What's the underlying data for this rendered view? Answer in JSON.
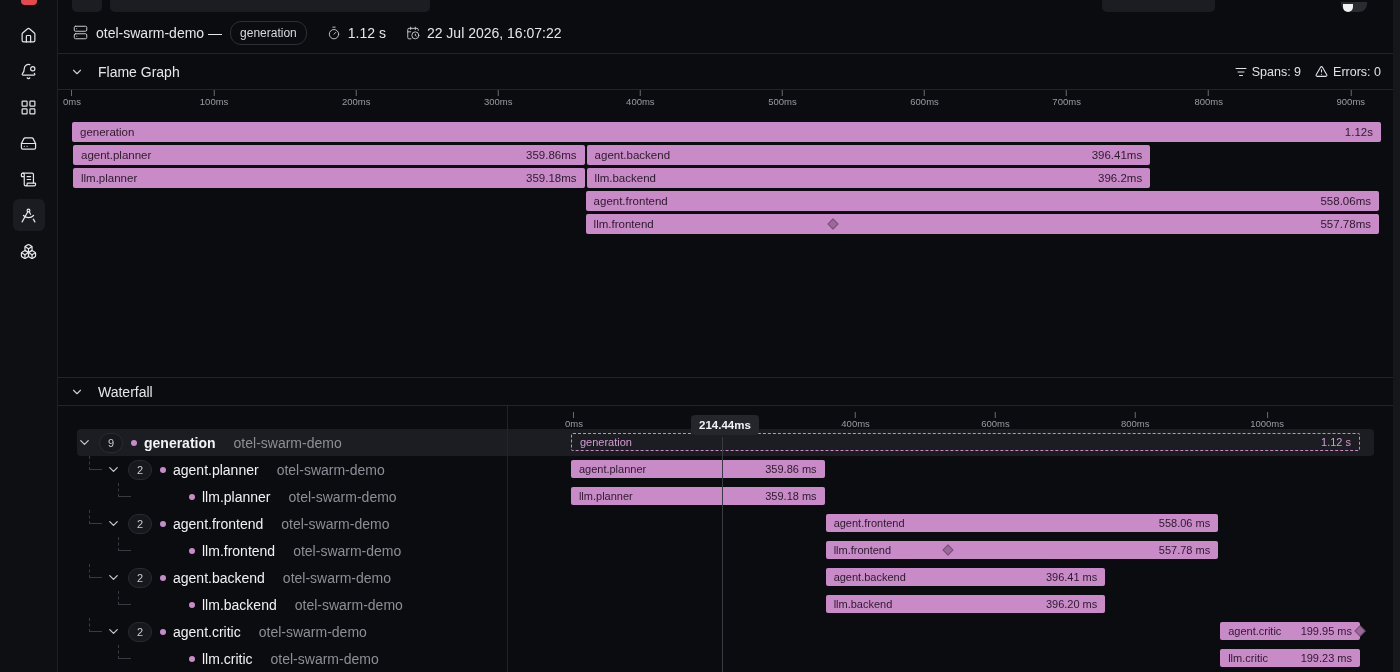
{
  "sidebar": {
    "items": [
      {
        "selected": false
      },
      {
        "selected": false
      },
      {
        "selected": false
      },
      {
        "selected": false
      },
      {
        "selected": false
      },
      {
        "selected": true
      },
      {
        "selected": false
      }
    ]
  },
  "toolbar": {
    "highlight_errors": {
      "on": false
    }
  },
  "header": {
    "service": "otel-swarm-demo —",
    "span_tag": "generation",
    "duration": "1.12 s",
    "timestamp": "22 Jul 2026, 16:07:22"
  },
  "flame_graph": {
    "title": "Flame Graph",
    "expanded": true,
    "spans_count": "Spans: 9",
    "errors_count": "Errors: 0",
    "axis_ticks": [
      "0ms",
      "100ms",
      "200ms",
      "300ms",
      "400ms",
      "500ms",
      "600ms",
      "700ms",
      "800ms",
      "900ms"
    ],
    "rows": [
      [
        {
          "name": "generation",
          "duration": "1.12s"
        }
      ],
      [
        {
          "name": "agent.planner",
          "duration": "359.86ms"
        },
        {
          "name": "agent.backend",
          "duration": "396.41ms"
        }
      ],
      [
        {
          "name": "llm.planner",
          "duration": "359.18ms"
        },
        {
          "name": "llm.backend",
          "duration": "396.2ms"
        }
      ],
      [
        {
          "name": "agent.frontend",
          "duration": "558.06ms"
        }
      ],
      [
        {
          "name": "llm.frontend",
          "duration": "557.78ms",
          "marker": true
        }
      ]
    ]
  },
  "waterfall": {
    "title": "Waterfall",
    "expanded": true,
    "axis_ticks": [
      "0ms",
      "400ms",
      "600ms",
      "800ms",
      "1000ms"
    ],
    "cursor_label": "214.44ms",
    "spans": [
      {
        "name": "generation",
        "service": "otel-swarm-demo",
        "count": "9",
        "expanded": true,
        "selected": true,
        "bar_label": "generation",
        "duration": "1.12 s",
        "children": [
          {
            "name": "agent.planner",
            "service": "otel-swarm-demo",
            "count": "2",
            "expanded": true,
            "selected": false,
            "bar_label": "agent.planner",
            "duration": "359.86 ms",
            "children": [
              {
                "name": "llm.planner",
                "service": "otel-swarm-demo",
                "selected": false,
                "bar_label": "llm.planner",
                "duration": "359.18 ms"
              }
            ]
          },
          {
            "name": "agent.frontend",
            "service": "otel-swarm-demo",
            "count": "2",
            "expanded": true,
            "selected": false,
            "bar_label": "agent.frontend",
            "duration": "558.06 ms",
            "children": [
              {
                "name": "llm.frontend",
                "service": "otel-swarm-demo",
                "selected": false,
                "bar_label": "llm.frontend",
                "duration": "557.78 ms",
                "marker": true
              }
            ]
          },
          {
            "name": "agent.backend",
            "service": "otel-swarm-demo",
            "count": "2",
            "expanded": true,
            "selected": false,
            "bar_label": "agent.backend",
            "duration": "396.41 ms",
            "children": [
              {
                "name": "llm.backend",
                "service": "otel-swarm-demo",
                "selected": false,
                "bar_label": "llm.backend",
                "duration": "396.20 ms"
              }
            ]
          },
          {
            "name": "agent.critic",
            "service": "otel-swarm-demo",
            "count": "2",
            "expanded": true,
            "selected": false,
            "bar_label": "agent.critic",
            "duration": "199.95 ms",
            "marker": true,
            "children": [
              {
                "name": "llm.critic",
                "service": "otel-swarm-demo",
                "selected": false,
                "bar_label": "llm.critic",
                "duration": "199.23 ms"
              }
            ]
          }
        ]
      }
    ]
  }
}
